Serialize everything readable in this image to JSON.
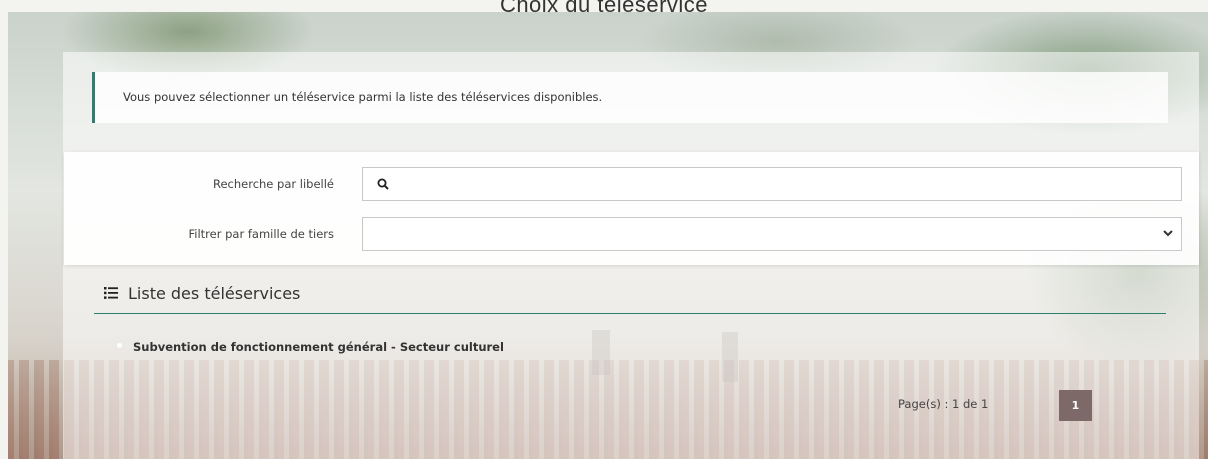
{
  "page": {
    "title": "Choix du téléservice"
  },
  "info": {
    "message": "Vous pouvez sélectionner un téléservice parmi la liste des téléservices disponibles."
  },
  "filters": {
    "search_label": "Recherche par libellé",
    "search_value": "",
    "family_label": "Filtrer par famille de tiers",
    "family_selected": ""
  },
  "list": {
    "title": "Liste des téléservices",
    "items": [
      {
        "label": "Subvention de fonctionnement général - Secteur culturel"
      }
    ]
  },
  "pagination": {
    "text": "Page(s) : 1 de 1",
    "current_page": "1"
  },
  "icons": {
    "search": "search-icon",
    "list": "list-icon",
    "dropdown": "chevron-down-icon"
  },
  "colors": {
    "accent": "#2e7f6e",
    "page_button": "#7d6a68"
  }
}
